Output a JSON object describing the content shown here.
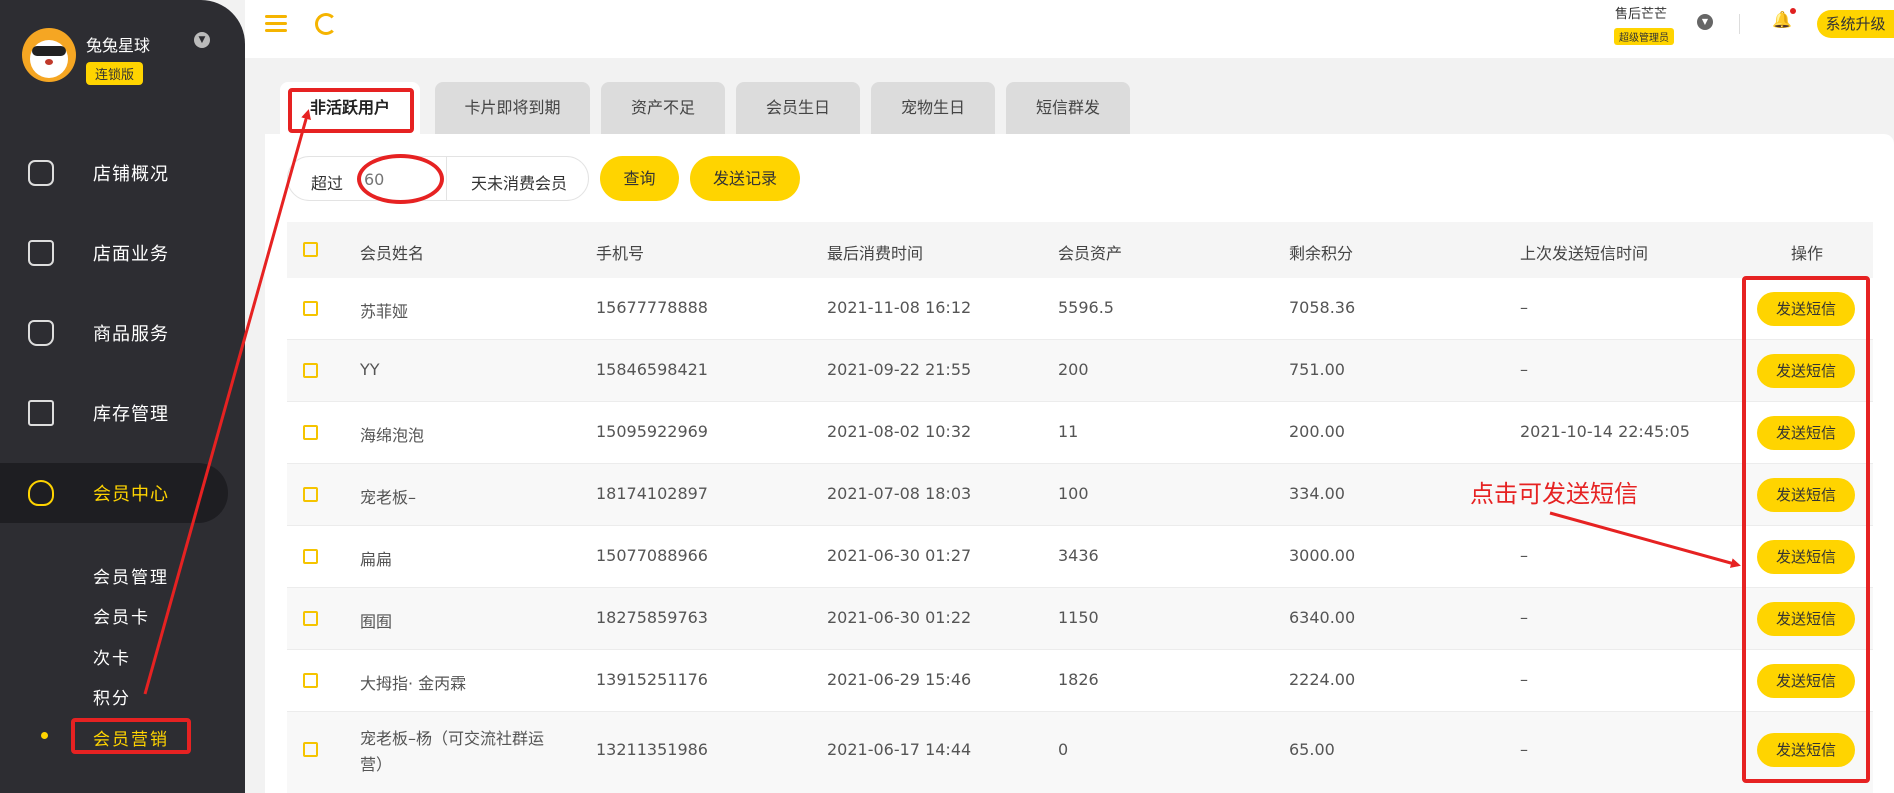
{
  "sidebar": {
    "brand_name": "兔兔星球",
    "brand_badge": "连锁版",
    "items": [
      {
        "label": "店铺概况"
      },
      {
        "label": "店面业务"
      },
      {
        "label": "商品服务"
      },
      {
        "label": "库存管理"
      },
      {
        "label": "会员中心"
      }
    ],
    "subitems": [
      {
        "label": "会员管理"
      },
      {
        "label": "会员卡"
      },
      {
        "label": "次卡"
      },
      {
        "label": "积分"
      },
      {
        "label": "会员营销"
      }
    ]
  },
  "header": {
    "user_name": "售后芒芒",
    "user_role": "超级管理员",
    "upgrade_label": "系统升级"
  },
  "tabs": [
    {
      "label": "非活跃用户"
    },
    {
      "label": "卡片即将到期"
    },
    {
      "label": "资产不足"
    },
    {
      "label": "会员生日"
    },
    {
      "label": "宠物生日"
    },
    {
      "label": "短信群发"
    }
  ],
  "filter": {
    "prefix": "超过",
    "days_placeholder": "60",
    "suffix": "天未消费会员",
    "query_label": "查询",
    "history_label": "发送记录"
  },
  "table": {
    "headers": [
      "会员姓名",
      "手机号",
      "最后消费时间",
      "会员资产",
      "剩余积分",
      "上次发送短信时间",
      "操作"
    ],
    "action_label": "发送短信",
    "rows": [
      {
        "name": "苏菲娅",
        "phone": "15677778888",
        "last_time": "2021-11-08 16:12",
        "assets": "5596.5",
        "points": "7058.36",
        "last_sms": "–"
      },
      {
        "name": "YY",
        "phone": "15846598421",
        "last_time": "2021-09-22 21:55",
        "assets": "200",
        "points": "751.00",
        "last_sms": "–"
      },
      {
        "name": "海绵泡泡",
        "phone": "15095922969",
        "last_time": "2021-08-02 10:32",
        "assets": "11",
        "points": "200.00",
        "last_sms": "2021-10-14 22:45:05"
      },
      {
        "name": "宠老板–",
        "phone": "18174102897",
        "last_time": "2021-07-08 18:03",
        "assets": "100",
        "points": "334.00",
        "last_sms": ""
      },
      {
        "name": "扁扁",
        "phone": "15077088966",
        "last_time": "2021-06-30 01:27",
        "assets": "3436",
        "points": "3000.00",
        "last_sms": "–"
      },
      {
        "name": "囿囿",
        "phone": "18275859763",
        "last_time": "2021-06-30 01:22",
        "assets": "1150",
        "points": "6340.00",
        "last_sms": "–"
      },
      {
        "name": "大拇指· 金丙霖",
        "phone": "13915251176",
        "last_time": "2021-06-29 15:46",
        "assets": "1826",
        "points": "2224.00",
        "last_sms": "–"
      },
      {
        "name": "宠老板–杨（可交流社群运营）",
        "phone": "13211351986",
        "last_time": "2021-06-17 14:44",
        "assets": "0",
        "points": "65.00",
        "last_sms": "–"
      }
    ]
  },
  "annotation": {
    "note": "点击可发送短信",
    "color": "#e62222"
  },
  "colors": {
    "accent": "#ffd400",
    "sidebar_bg": "#2d2d32"
  }
}
